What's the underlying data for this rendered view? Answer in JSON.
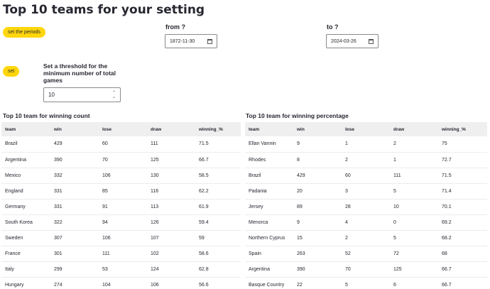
{
  "page": {
    "title": "Top 10 teams for your setting"
  },
  "periods": {
    "button_label": "set the periods",
    "from_label": "from ?",
    "from_value": "1872-11-30",
    "to_label": "to ?",
    "to_value": "2024-03-26"
  },
  "threshold": {
    "button_label": "set",
    "label": "Set a threshold for the minimum number of total games",
    "value": "10"
  },
  "winning_count": {
    "title": "Top 10 team for winning count",
    "columns": [
      "team",
      "win",
      "lose",
      "draw",
      "winning_%"
    ],
    "rows": [
      [
        "Brazil",
        "429",
        "60",
        "111",
        "71.5"
      ],
      [
        "Argentina",
        "390",
        "70",
        "125",
        "66.7"
      ],
      [
        "Mexico",
        "332",
        "106",
        "130",
        "58.5"
      ],
      [
        "England",
        "331",
        "85",
        "116",
        "62.2"
      ],
      [
        "Germany",
        "331",
        "91",
        "113",
        "61.9"
      ],
      [
        "South Korea",
        "322",
        "94",
        "126",
        "59.4"
      ],
      [
        "Sweden",
        "307",
        "106",
        "107",
        "59"
      ],
      [
        "France",
        "301",
        "111",
        "102",
        "58.6"
      ],
      [
        "Italy",
        "299",
        "53",
        "124",
        "62.8"
      ],
      [
        "Hungary",
        "274",
        "104",
        "106",
        "56.6"
      ]
    ]
  },
  "winning_percentage": {
    "title": "Top 10 team for winning percentage",
    "columns": [
      "team",
      "win",
      "lose",
      "draw",
      "winning_%"
    ],
    "rows": [
      [
        "Ellan Vannin",
        "9",
        "1",
        "2",
        "75"
      ],
      [
        "Rhodes",
        "8",
        "2",
        "1",
        "72.7"
      ],
      [
        "Brazil",
        "429",
        "60",
        "111",
        "71.5"
      ],
      [
        "Padania",
        "20",
        "3",
        "5",
        "71.4"
      ],
      [
        "Jersey",
        "89",
        "28",
        "10",
        "70.1"
      ],
      [
        "Menorca",
        "9",
        "4",
        "0",
        "69.2"
      ],
      [
        "Northern Cyprus",
        "15",
        "2",
        "5",
        "68.2"
      ],
      [
        "Spain",
        "263",
        "52",
        "72",
        "68"
      ],
      [
        "Argentina",
        "390",
        "70",
        "125",
        "66.7"
      ],
      [
        "Basque Country",
        "22",
        "5",
        "6",
        "66.7"
      ]
    ]
  }
}
